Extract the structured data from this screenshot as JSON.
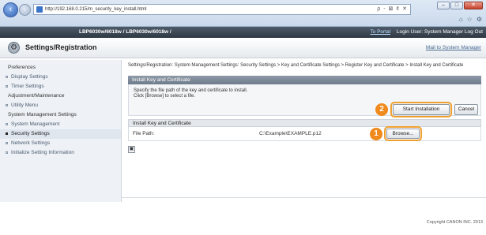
{
  "browser": {
    "url": "http://192.168.0.215/m_security_key_install.html",
    "address_tools": "ρ - ⊠ ¢ ✕",
    "tool_icons": [
      "home-icon",
      "star-icon",
      "gear-icon"
    ],
    "window_controls": [
      "–",
      "□",
      "✕"
    ]
  },
  "device": {
    "model": "LBP6030w/6018w / LBP6030w/6018w /",
    "portal": "To Portal",
    "login": "Login User: System Manager  Log Out"
  },
  "header": {
    "title": "Settings/Registration",
    "mail_link": "Mail to System Manager"
  },
  "sidebar": {
    "groups": [
      {
        "head": "Preferences",
        "items": [
          "Display Settings",
          "Timer Settings"
        ]
      },
      {
        "head": "Adjustment/Maintenance",
        "items": [
          "Utility Menu"
        ]
      },
      {
        "head": "System Management Settings",
        "items": [
          "System Management",
          "Security Settings",
          "Network Settings",
          "Initialize Setting Information"
        ]
      }
    ]
  },
  "main": {
    "breadcrumb": "Settings/Registration: System Management Settings: Security Settings > Key and Certificate Settings > Register Key and Certificate > Install Key and Certificate",
    "section_title": "Install Key and Certificate",
    "instructions": [
      "Specify the file path of the key and certificate to install.",
      "Click [Browse] to select a file."
    ],
    "start_button": "Start Installation",
    "cancel_button": "Cancel",
    "subsection_title": "Install Key and Certificate",
    "file_path_label": "File Path:",
    "file_path_value": "C:\\Example\\EXAMPLE.p12",
    "browse_button": "Browse...",
    "callouts": [
      "2",
      "1"
    ],
    "save_icon": "save-icon"
  },
  "footer": {
    "copyright": "Copyright CANON INC. 2013"
  },
  "colors": {
    "callout": "#f08a1c",
    "highlight": "#f0a030"
  }
}
